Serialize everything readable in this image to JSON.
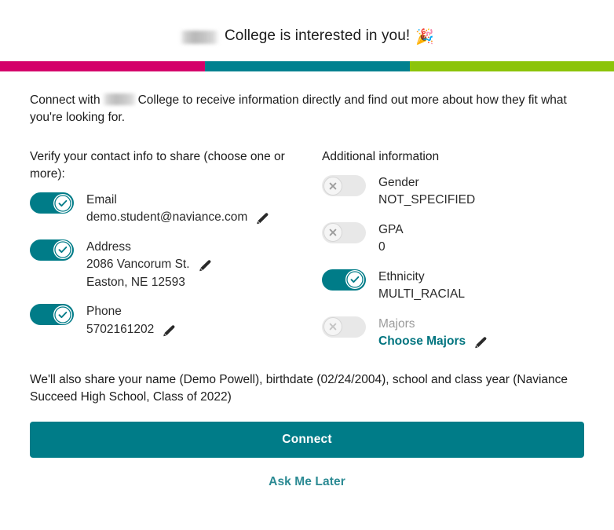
{
  "header": {
    "redacted_name": "",
    "title_text": "College is interested in you!",
    "party_icon": "party-popper-icon",
    "party_glyph": "🎉"
  },
  "colorbar": {
    "pink": "#d4006a",
    "teal": "#00818f",
    "green": "#8cc40a"
  },
  "intro": {
    "before": "Connect with",
    "after": "College to receive information directly and find out more about how they fit what you're looking for."
  },
  "left_column": {
    "heading": "Verify your contact info to share (choose one or more):",
    "options": [
      {
        "label": "Email",
        "value": "demo.student@naviance.com",
        "value_line2": "",
        "state": "on",
        "edit_icon": "pencil-icon",
        "has_edit": true
      },
      {
        "label": "Address",
        "value": "2086 Vancorum St.",
        "value_line2": "Easton, NE 12593",
        "state": "on",
        "edit_icon": "pencil-icon",
        "has_edit": true
      },
      {
        "label": "Phone",
        "value": "5702161202",
        "value_line2": "",
        "state": "on",
        "edit_icon": "pencil-icon",
        "has_edit": true
      }
    ]
  },
  "right_column": {
    "heading": "Additional information",
    "options": [
      {
        "label": "Gender",
        "value": "NOT_SPECIFIED",
        "state": "off",
        "has_edit": false,
        "is_link": false,
        "label_dim": false
      },
      {
        "label": "GPA",
        "value": "0",
        "state": "off",
        "has_edit": false,
        "is_link": false,
        "label_dim": false
      },
      {
        "label": "Ethnicity",
        "value": "MULTI_RACIAL",
        "state": "on",
        "has_edit": false,
        "is_link": false,
        "label_dim": false
      },
      {
        "label": "Majors",
        "value": "Choose Majors",
        "state": "off",
        "has_edit": true,
        "edit_icon": "pencil-icon",
        "is_link": true,
        "label_dim": true
      }
    ]
  },
  "footer": {
    "disclaimer": "We'll also share your name (Demo Powell), birthdate (02/24/2004), school and class year (Naviance Succeed High School, Class of 2022)",
    "connect_label": "Connect",
    "ask_later_label": "Ask Me Later"
  },
  "colors": {
    "accent_teal": "#007c88",
    "link_teal": "#00747f",
    "ask_later_teal": "#2b8a93",
    "toggle_off": "#e8e8e8"
  }
}
